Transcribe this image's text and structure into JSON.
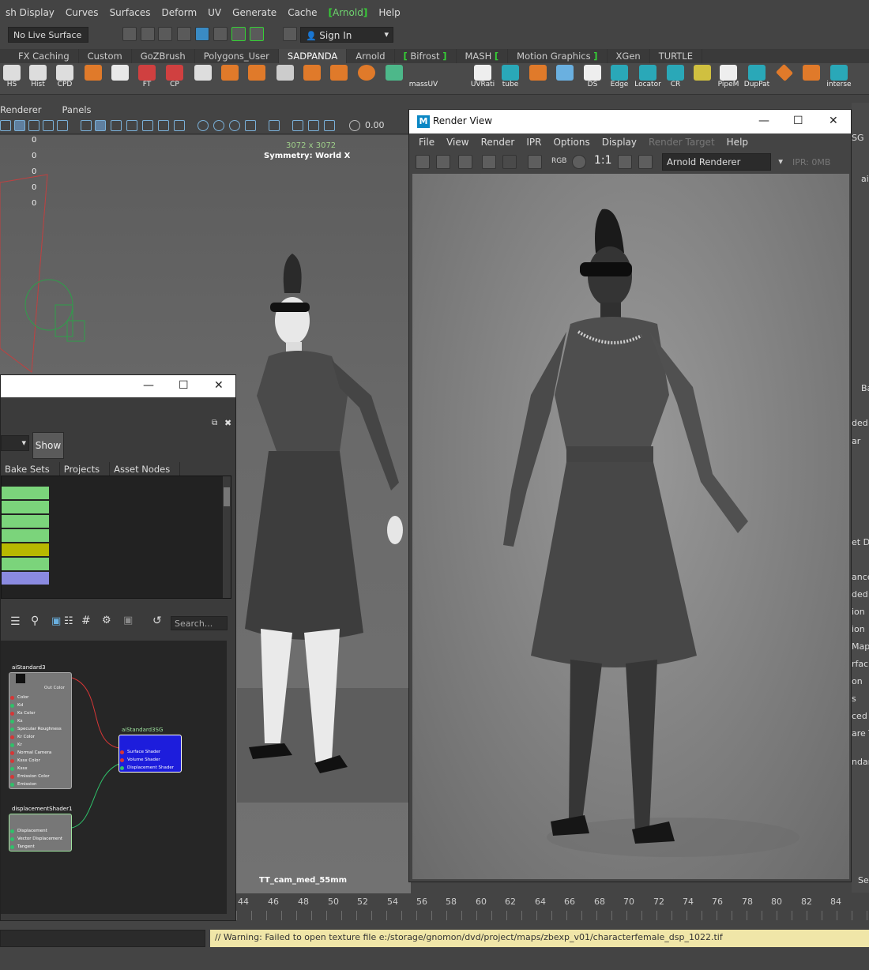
{
  "menubar": {
    "items": [
      "sh Display",
      "Curves",
      "Surfaces",
      "Deform",
      "UV",
      "Generate",
      "Cache",
      "Arnold",
      "Help"
    ],
    "arnold_bracket_left": "[",
    "arnold_bracket_right": "]"
  },
  "statusline": {
    "live_surface": "No Live Surface",
    "sign_in": "Sign In"
  },
  "shelf_tabs": [
    "FX Caching",
    "Custom",
    "GoZBrush",
    "Polygons_User",
    "SADPANDA",
    "Arnold",
    "Bifrost",
    "MASH",
    "Motion Graphics",
    "XGen",
    "TURTLE"
  ],
  "shelf_active": "SADPANDA",
  "shelf_buttons": [
    "HS",
    "Hist",
    "CPD",
    "FT",
    "CP",
    "massUV",
    "UVRati",
    "tube",
    "DS",
    "Edge",
    "Locator",
    "CR",
    "PipeM",
    "DupPat",
    "interse"
  ],
  "viewport": {
    "menu": [
      "Renderer",
      "Panels"
    ],
    "field_value": "0.00",
    "numbers": [
      "0",
      "0",
      "0",
      "0",
      "0"
    ],
    "resolution": "3072 x 3072",
    "symmetry": "Symmetry: World X",
    "camera": "TT_cam_med_55mm"
  },
  "hypershade": {
    "show_button": "Show",
    "tabs": [
      "Bake Sets",
      "Projects",
      "Asset Nodes"
    ],
    "search_placeholder": "Search...",
    "bar_colors": [
      "#7bd47b",
      "#7bd47b",
      "#7bd47b",
      "#7bd47b",
      "#b8b800",
      "#7bd47b",
      "#8a8ae0"
    ],
    "nodes": {
      "standard": {
        "title": "aiStandard3",
        "out": "Out Color",
        "attrs": [
          "Color",
          "Kd",
          "Ks Color",
          "Ks",
          "Specular Roughness",
          "Kr Color",
          "Kr",
          "Normal Camera",
          "Kssx Color",
          "Kssx",
          "Emission Color",
          "Emission"
        ]
      },
      "sg": {
        "title": "aiStandard3SG",
        "attrs": [
          "Surface Shader",
          "Volume Shader",
          "Displacement Shader"
        ]
      },
      "disp": {
        "title": "displacementShader1",
        "attrs": [
          "Displacement",
          "Vector Displacement",
          "Tangent"
        ]
      }
    }
  },
  "render_view": {
    "title": "Render View",
    "menu": [
      "File",
      "View",
      "Render",
      "IPR",
      "Options",
      "Display",
      "Render Target",
      "Help"
    ],
    "ratio": "1:1",
    "rgb": "RGB",
    "renderer": "Arnold Renderer",
    "ipr": "IPR: 0MB"
  },
  "timeline": {
    "ticks": [
      "44",
      "46",
      "48",
      "50",
      "52",
      "54",
      "56",
      "58",
      "60",
      "62",
      "64",
      "66",
      "68",
      "70",
      "72",
      "74",
      "76",
      "78",
      "80",
      "82",
      "84"
    ]
  },
  "command": {
    "warning": "// Warning: Failed to open texture file e:/storage/gnomon/dvd/project/maps/zbexp_v01/characterfemale_dsp_1022.tif"
  },
  "right_panel": [
    "SG",
    "ai",
    "Ba",
    "ded",
    "ar",
    "et D",
    "ance",
    "ded",
    "ion",
    "ion",
    "Map",
    "rfac",
    "on",
    "s",
    "ced",
    "are T",
    "ndar",
    "Se"
  ]
}
